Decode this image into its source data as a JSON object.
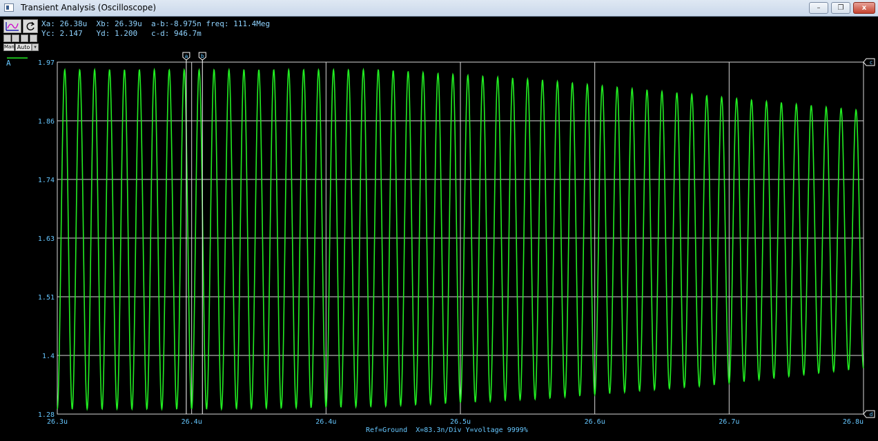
{
  "window": {
    "title": "Transient Analysis (Oscilloscope)",
    "buttons": {
      "minimize": "–",
      "maximize": "❐",
      "close": "x"
    }
  },
  "toolbar": {
    "cursor_tool": "waveform-cursor-icon",
    "reset_tool": "refresh-icon",
    "man_label": "Man",
    "auto_label": "Auto"
  },
  "readouts": {
    "row1": "Xa: 26.38u  Xb: 26.39u  a-b:-8.975n freq: 111.4Meg",
    "row2": "Yc: 2.147   Yd: 1.200   c-d: 946.7m"
  },
  "trace_label": "A",
  "cursor_labels": {
    "a": "a",
    "b": "b",
    "c": "c",
    "d": "d"
  },
  "footer": "Ref=Ground  X=83.3n/Div Y=voltage 9999%",
  "colors": {
    "trace": "#22ee22",
    "grid": "#d8d8d8",
    "labels": "#66c7ff",
    "background": "#000000"
  },
  "chart_data": {
    "type": "line",
    "x_tick_labels": [
      "26.3u",
      "26.4u",
      "26.4u",
      "26.5u",
      "26.6u",
      "26.7u",
      "26.8u"
    ],
    "y_tick_labels": [
      "1.97",
      "1.86",
      "1.74",
      "1.63",
      "1.51",
      "1.4",
      "1.28"
    ],
    "xlim": [
      26.3,
      26.8
    ],
    "ylim": [
      1.28,
      1.97
    ],
    "x_unit": "u",
    "grid": true,
    "cursors": {
      "xa": 26.38,
      "xb": 26.39
    },
    "series": [
      {
        "frequency": "111.4Meg",
        "cycles": 54,
        "x_start": 26.3,
        "x_end": 26.8,
        "max_envelope": {
          "x": [
            26.3,
            26.4,
            26.5,
            26.6,
            26.7,
            26.8
          ],
          "y": [
            1.955,
            1.955,
            1.955,
            1.935,
            1.905,
            1.875
          ]
        },
        "min_envelope": {
          "x": [
            26.3,
            26.4,
            26.5,
            26.6,
            26.7,
            26.8
          ],
          "y": [
            1.29,
            1.29,
            1.295,
            1.31,
            1.335,
            1.37
          ]
        }
      }
    ]
  }
}
